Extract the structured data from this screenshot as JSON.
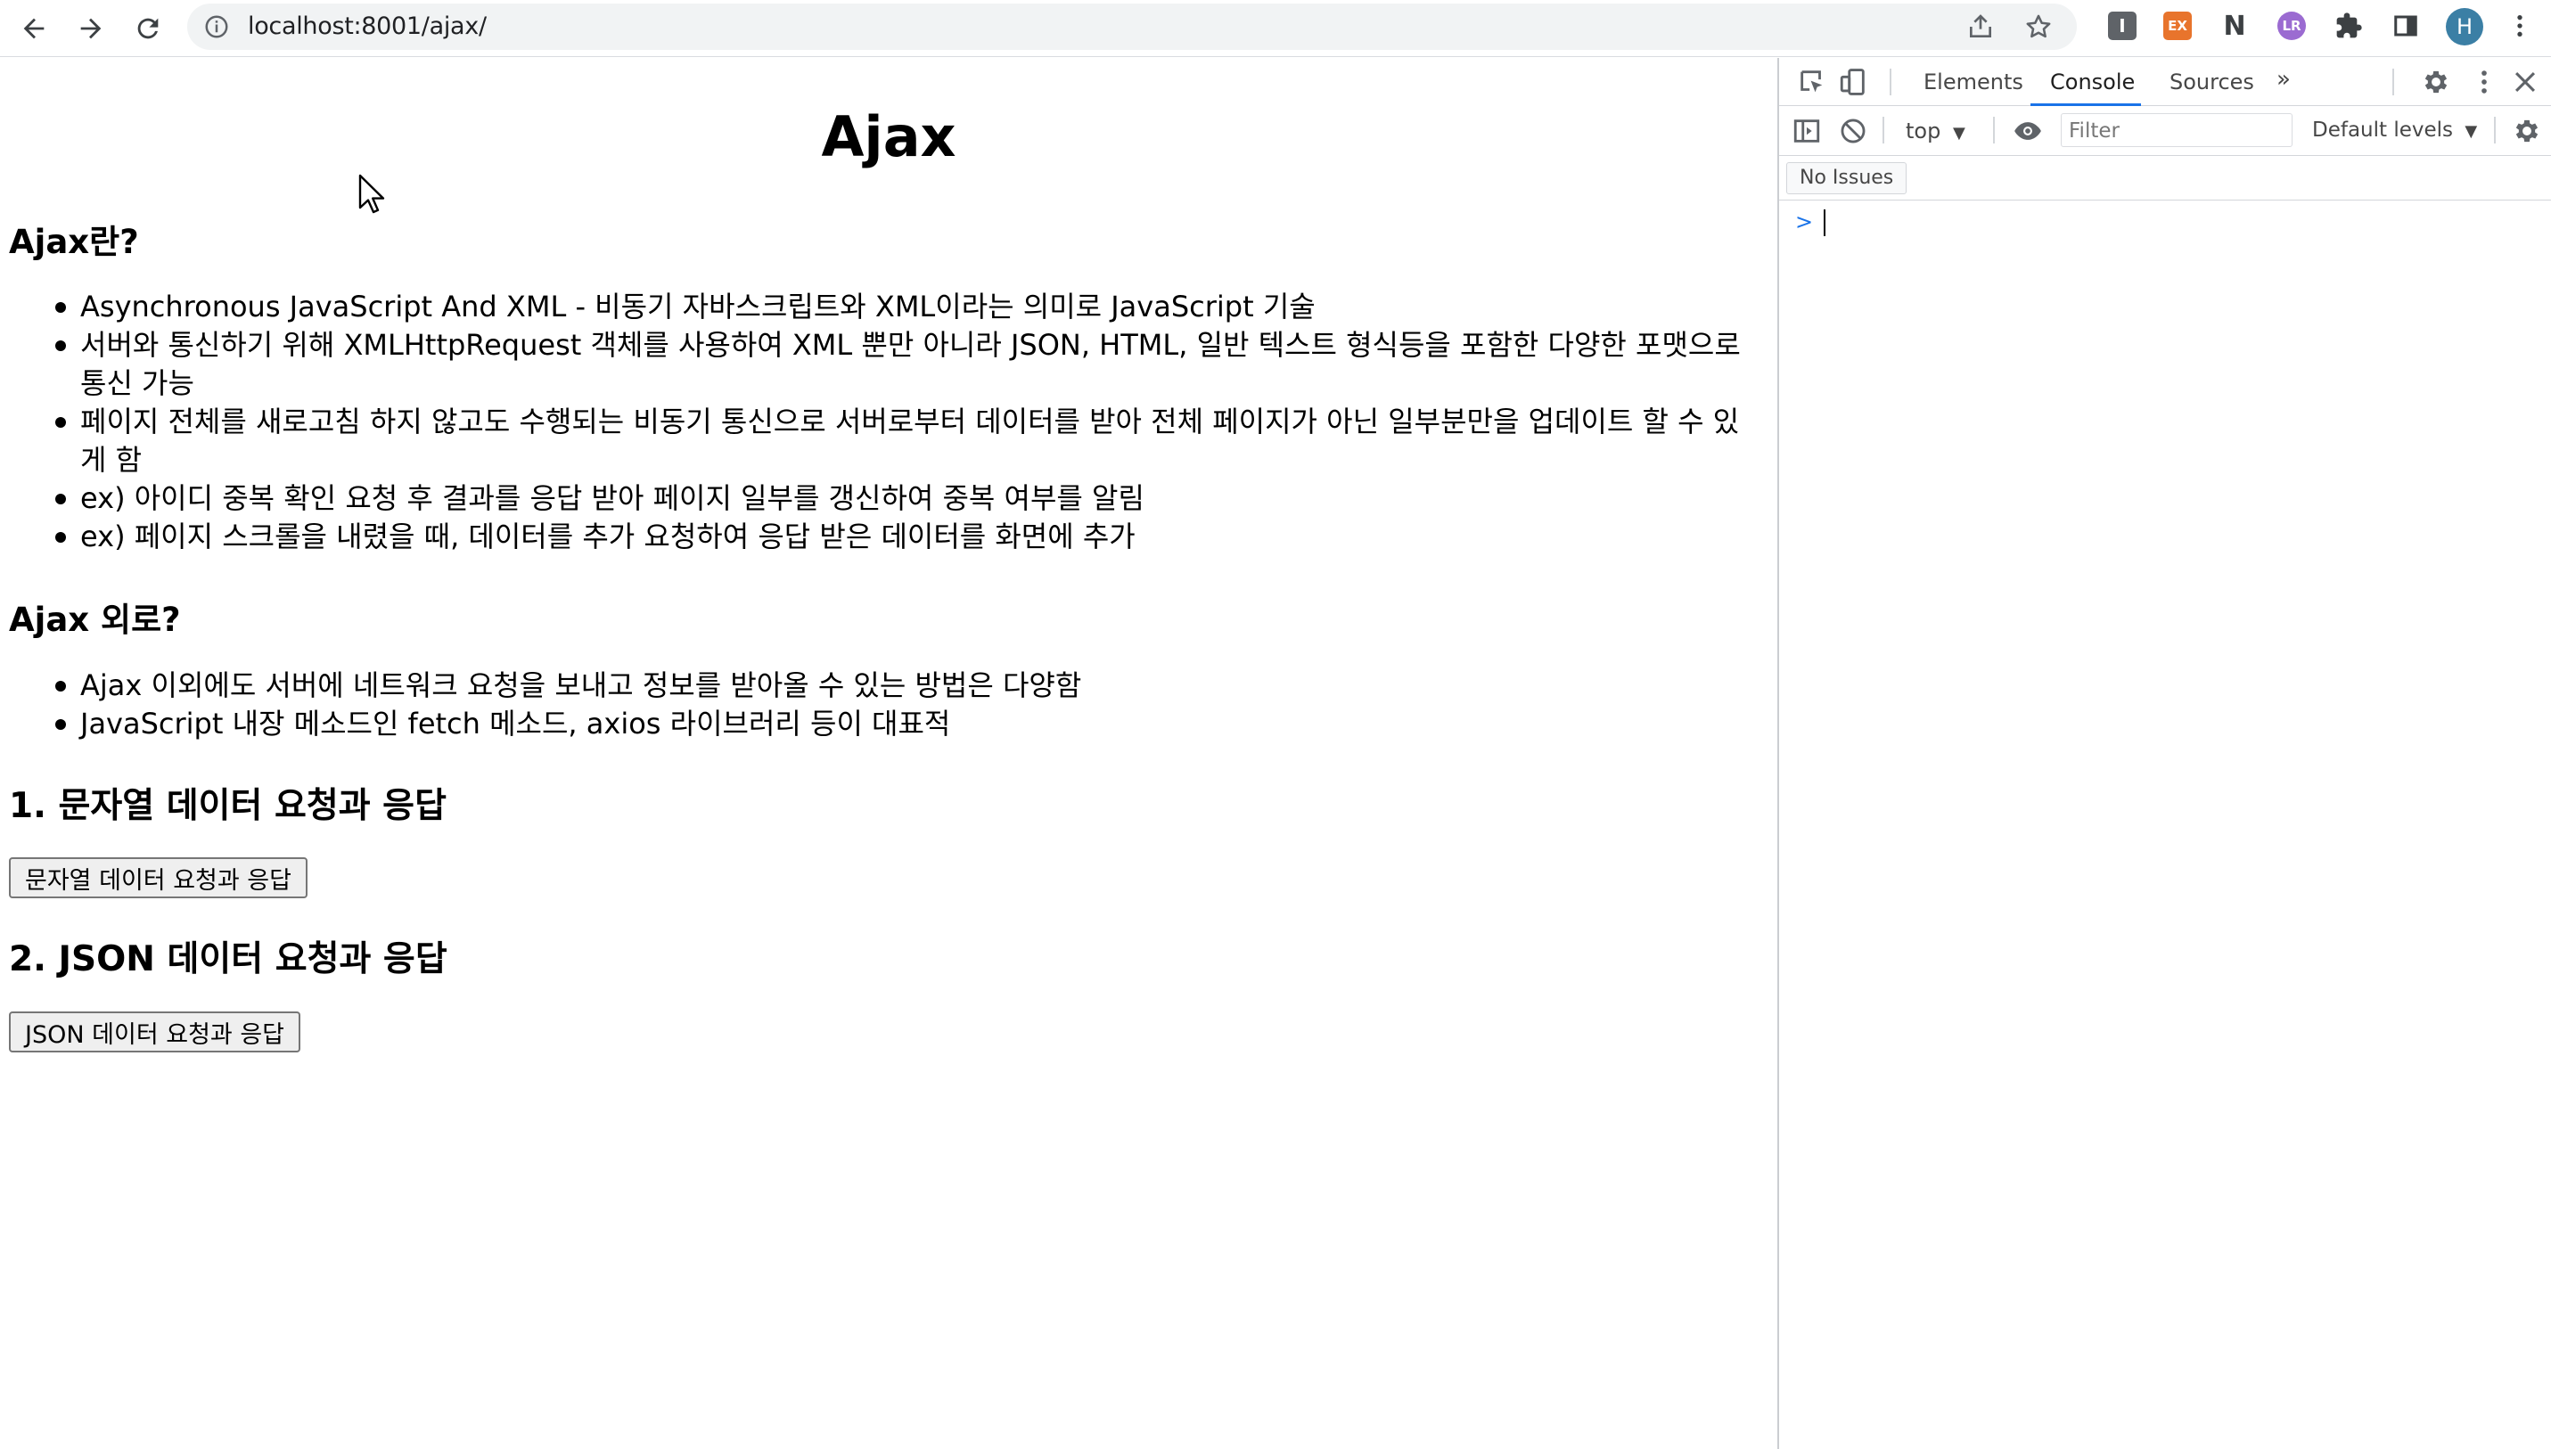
{
  "browser": {
    "url": "localhost:8001/ajax/",
    "profile_initial": "H",
    "extensions": [
      {
        "name": "extension-i-icon",
        "label": "I",
        "color": "#5f6368"
      },
      {
        "name": "extension-ex-icon",
        "label": "EX",
        "color": "#e8742c"
      },
      {
        "name": "extension-n-icon",
        "label": "N",
        "color": "#3c4043"
      },
      {
        "name": "extension-lr-icon",
        "label": "LR",
        "color": "#9b6bd1"
      }
    ]
  },
  "page": {
    "title": "Ajax",
    "section1": {
      "heading": "Ajax란?",
      "items": [
        "Asynchronous JavaScript And XML - 비동기 자바스크립트와 XML이라는 의미로 JavaScript 기술",
        "서버와 통신하기 위해 XMLHttpRequest 객체를 사용하여 XML 뿐만 아니라 JSON, HTML, 일반 텍스트 형식등을 포함한 다양한 포맷으로 통신 가능",
        "페이지 전체를 새로고침 하지 않고도 수행되는 비동기 통신으로 서버로부터 데이터를 받아 전체 페이지가 아닌 일부분만을 업데이트 할 수 있게 함",
        "ex) 아이디 중복 확인 요청 후 결과를 응답 받아 페이지 일부를 갱신하여 중복 여부를 알림",
        "ex) 페이지 스크롤을 내렸을 때, 데이터를 추가 요청하여 응답 받은 데이터를 화면에 추가"
      ]
    },
    "section2": {
      "heading": "Ajax 외로?",
      "items": [
        "Ajax 이외에도 서버에 네트워크 요청을 보내고 정보를 받아올 수 있는 방법은 다양함",
        "JavaScript 내장 메소드인 fetch 메소드, axios 라이브러리 등이 대표적"
      ]
    },
    "string_section": {
      "heading": "1. 문자열 데이터 요청과 응답",
      "button": "문자열 데이터 요청과 응답"
    },
    "json_section": {
      "heading": "2. JSON 데이터 요청과 응답",
      "button": "JSON 데이터 요청과 응답"
    }
  },
  "devtools": {
    "tabs": [
      "Elements",
      "Console",
      "Sources"
    ],
    "active_tab": "Console",
    "more_tabs": "»",
    "context": "top",
    "filter_placeholder": "Filter",
    "levels": "Default levels",
    "issues": "No Issues",
    "prompt": ">"
  }
}
